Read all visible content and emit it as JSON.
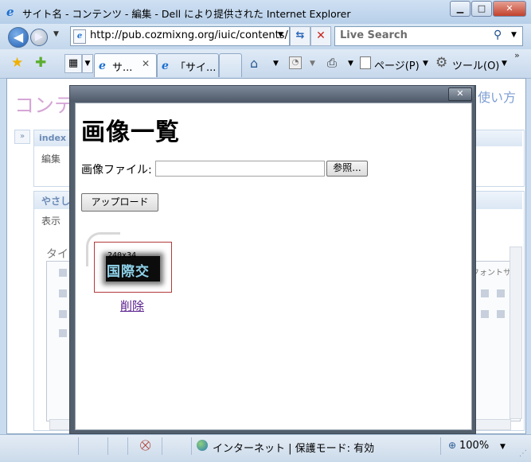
{
  "window": {
    "title": "サイト名 - コンテンツ - 編集 - Dell により提供された Internet Explorer",
    "minimize": "▁",
    "maximize": "□",
    "close": "✕"
  },
  "address": {
    "url": "http://pub.cozmixng.org/iuic/contents/"
  },
  "search": {
    "placeholder": "Live Search"
  },
  "tabs": [
    {
      "label": "サ...",
      "active": true
    },
    {
      "label": "「サイ...",
      "active": false
    }
  ],
  "toolbar": {
    "page_menu": "ページ(P)",
    "tools_menu": "ツール(O)"
  },
  "background_page": {
    "title": "コンテ",
    "howto_link": "使い方",
    "panel1_header": "index",
    "panel1_item": "編集",
    "panel2_header": "やさしい",
    "panel2_item": "表示",
    "title_label": "タイ",
    "font_size_label": "フォントサ"
  },
  "dialog": {
    "heading": "画像一覧",
    "file_label": "画像ファイル:",
    "file_value": "",
    "browse_label": "参照...",
    "upload_label": "アップロード",
    "thumbnail": {
      "size_text": "240x34",
      "image_text": "国際交"
    },
    "delete_link": "削除"
  },
  "status": {
    "zone": "インターネット | 保護モード: 有効",
    "zoom": "100%"
  },
  "colors": {
    "accent": "#1c6fd1",
    "visited_link": "#551a8b",
    "thumb_border": "#b23a3a"
  }
}
